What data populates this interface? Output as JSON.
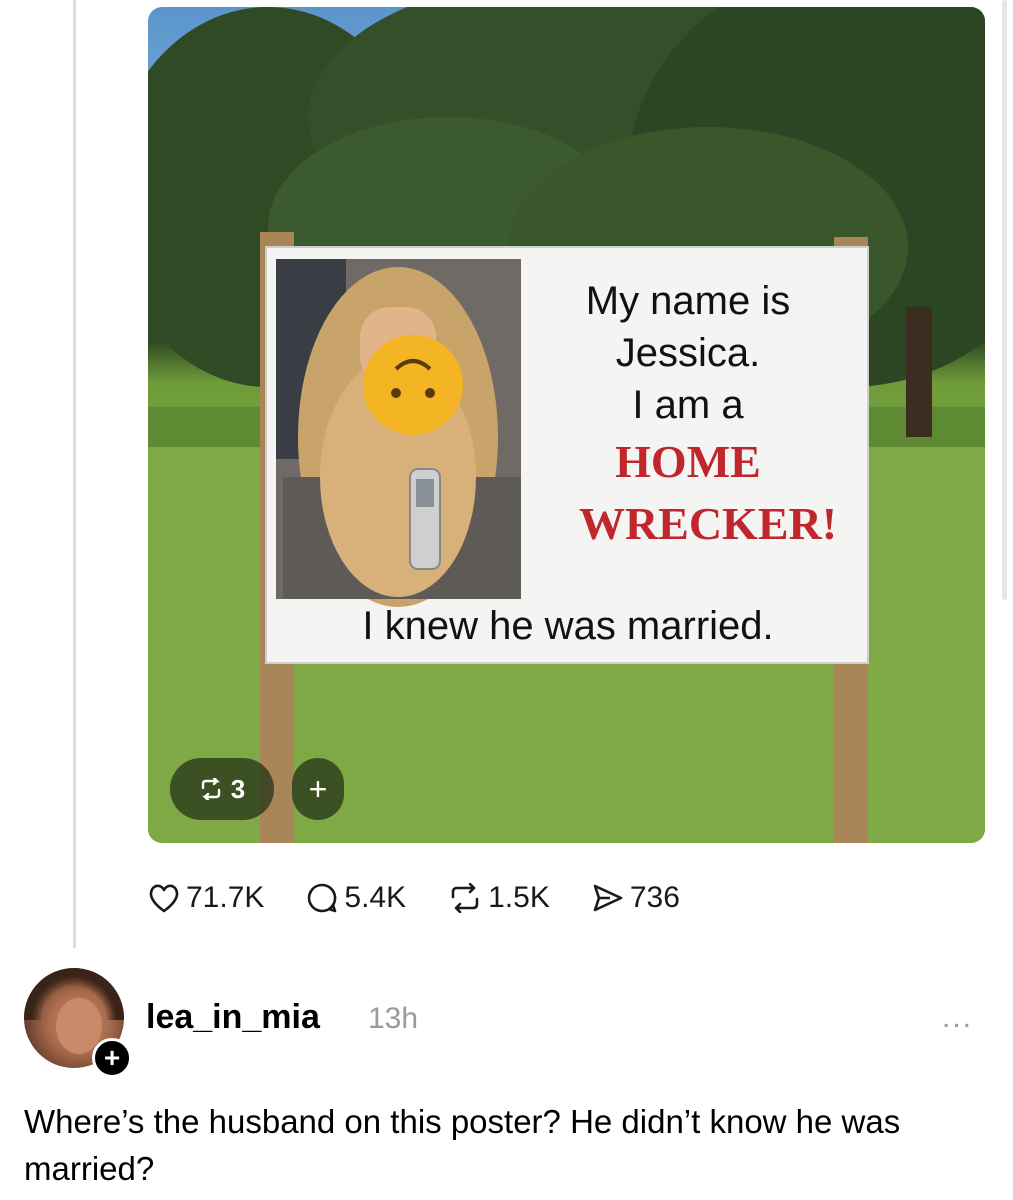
{
  "post": {
    "image": {
      "sign": {
        "line1": "My name is",
        "line2": "Jessica.",
        "line3": "I am a",
        "line4": "HOME",
        "line5": "WRECKER!",
        "line6": "I knew he was married."
      },
      "repost_badge_count": "3",
      "add_badge": "+"
    },
    "stats": {
      "likes": "71.7K",
      "comments": "5.4K",
      "reposts": "1.5K",
      "shares": "736"
    }
  },
  "reply": {
    "username": "lea_in_mia",
    "timestamp": "13h",
    "more": "...",
    "follow": "+",
    "text": "Where’s the husband on this poster? He didn’t know he was married?"
  },
  "icons": {
    "like": "heart-icon",
    "comment": "comment-bubble-icon",
    "repost": "repost-icon",
    "share": "send-icon",
    "more": "more-dots-icon"
  },
  "colors": {
    "sign_red": "#c0272d",
    "sign_bg": "#f4f4f2",
    "badge_bg": "#2f3a1c"
  }
}
